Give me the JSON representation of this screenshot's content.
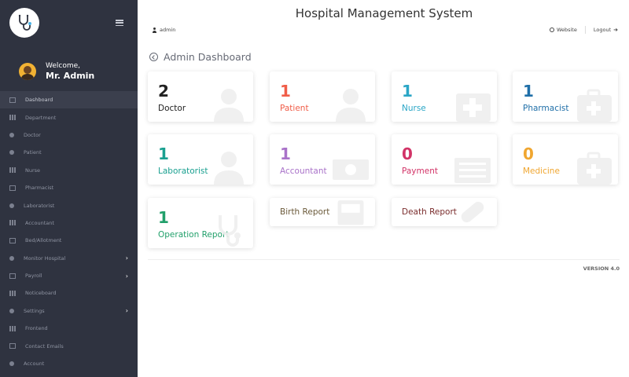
{
  "app": {
    "title": "Hospital Management System"
  },
  "header": {
    "user": "admin",
    "website_label": "Website",
    "logout_label": "Logout"
  },
  "sidebar": {
    "welcome_line": "Welcome,",
    "welcome_name": "Mr. Admin",
    "items": [
      {
        "label": "Dashboard",
        "icon": "dashboard-icon"
      },
      {
        "label": "Department",
        "icon": "department-icon"
      },
      {
        "label": "Doctor",
        "icon": "doctor-icon"
      },
      {
        "label": "Patient",
        "icon": "patient-icon"
      },
      {
        "label": "Nurse",
        "icon": "nurse-icon"
      },
      {
        "label": "Pharmacist",
        "icon": "pharmacist-icon"
      },
      {
        "label": "Laboratorist",
        "icon": "laboratorist-icon"
      },
      {
        "label": "Accountant",
        "icon": "accountant-icon"
      },
      {
        "label": "Bed/Allotment",
        "icon": "bed-icon"
      },
      {
        "label": "Monitor Hospital",
        "icon": "monitor-icon"
      },
      {
        "label": "Payroll",
        "icon": "payroll-icon"
      },
      {
        "label": "Noticeboard",
        "icon": "noticeboard-icon"
      },
      {
        "label": "Settings",
        "icon": "settings-icon"
      },
      {
        "label": "Frontend",
        "icon": "frontend-icon"
      },
      {
        "label": "Contact Emails",
        "icon": "email-icon"
      },
      {
        "label": "Account",
        "icon": "account-icon"
      }
    ]
  },
  "page": {
    "title": "Admin Dashboard"
  },
  "cards": [
    {
      "count": "2",
      "label": "Doctor",
      "color": "#222222",
      "icon": "doctor-icon"
    },
    {
      "count": "1",
      "label": "Patient",
      "color": "#f05d48",
      "icon": "patient-icon"
    },
    {
      "count": "1",
      "label": "Nurse",
      "color": "#2aa6c6",
      "icon": "nurse-icon"
    },
    {
      "count": "1",
      "label": "Pharmacist",
      "color": "#1f6fa8",
      "icon": "medical-kit-icon"
    },
    {
      "count": "1",
      "label": "Laboratorist",
      "color": "#1aa090",
      "icon": "laboratorist-icon"
    },
    {
      "count": "1",
      "label": "Accountant",
      "color": "#a972c9",
      "icon": "money-icon"
    },
    {
      "count": "0",
      "label": "Payment",
      "color": "#d23367",
      "icon": "list-icon"
    },
    {
      "count": "0",
      "label": "Medicine",
      "color": "#f0a630",
      "icon": "medical-kit-icon"
    },
    {
      "count": "1",
      "label": "Operation Report",
      "color": "#22a06b",
      "icon": "stethoscope-icon"
    },
    {
      "count": "",
      "label": "Birth Report",
      "color": "#6b5a3a",
      "icon": "inbox-icon"
    },
    {
      "count": "",
      "label": "Death Report",
      "color": "#7a2d2d",
      "icon": "bandage-icon"
    }
  ],
  "footer": {
    "version": "VERSION 4.0"
  }
}
